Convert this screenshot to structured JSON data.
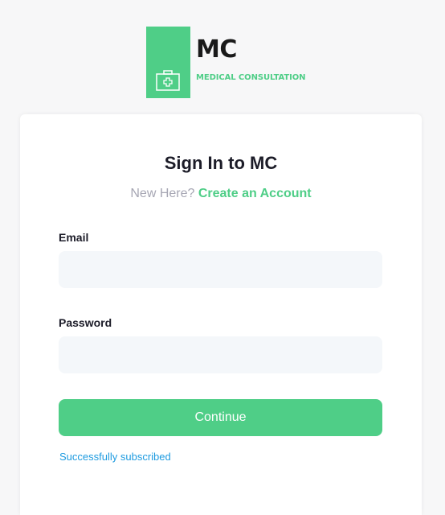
{
  "logo": {
    "title": "MC",
    "subtitle": "MEDICAL CONSULTATION",
    "icon": "first-aid-kit-icon",
    "color": "#4fce87"
  },
  "signin": {
    "title": "Sign In to MC",
    "new_here": "New Here?",
    "create_account": "Create an Account",
    "email_label": "Email",
    "email_value": "",
    "password_label": "Password",
    "password_value": "",
    "continue_label": "Continue",
    "status_message": "Successfully subscribed"
  },
  "colors": {
    "accent": "#4fce87",
    "input_bg": "#f4f7fa",
    "status_link": "#1e9be0"
  }
}
